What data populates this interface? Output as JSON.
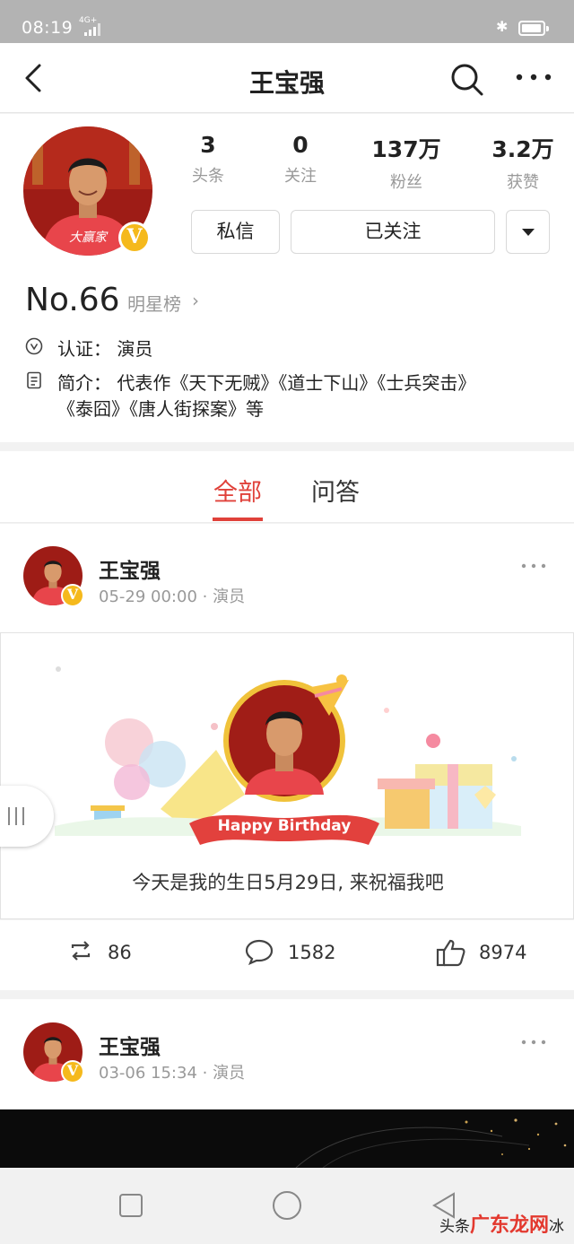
{
  "status_bar": {
    "time": "08:19",
    "network": "4G+"
  },
  "nav": {
    "title": "王宝强"
  },
  "profile": {
    "badge": "V",
    "stats": [
      {
        "num": "3",
        "label": "头条"
      },
      {
        "num": "0",
        "label": "关注"
      },
      {
        "num": "137万",
        "label": "粉丝"
      },
      {
        "num": "3.2万",
        "label": "获赞"
      }
    ],
    "message_button": "私信",
    "follow_button": "已关注",
    "rank": "No.66",
    "rank_label": "明星榜",
    "rank_chevron": "›",
    "verification": "认证：  演员",
    "intro_line1": "简介：  代表作《天下无贼》《道士下山》《士兵突击》",
    "intro_line2": "《泰囧》《唐人街探案》等"
  },
  "tabs": [
    {
      "label": "全部"
    },
    {
      "label": "问答"
    }
  ],
  "posts": [
    {
      "author": "王宝强",
      "meta": "05-29 00:00 · 演员",
      "banner_text": "Happy Birthday",
      "caption": "今天是我的生日5月29日, 来祝福我吧",
      "reposts": "86",
      "comments": "1582",
      "likes": "8974"
    },
    {
      "author": "王宝强",
      "meta": "03-06 15:34 · 演员"
    }
  ],
  "watermark": {
    "prefix": "头条",
    "brand": "广东龙网",
    "suffix": "冰"
  },
  "colors": {
    "accent": "#e0413a",
    "badge": "#f5b91c",
    "status_bar": "#b3b3b3"
  }
}
